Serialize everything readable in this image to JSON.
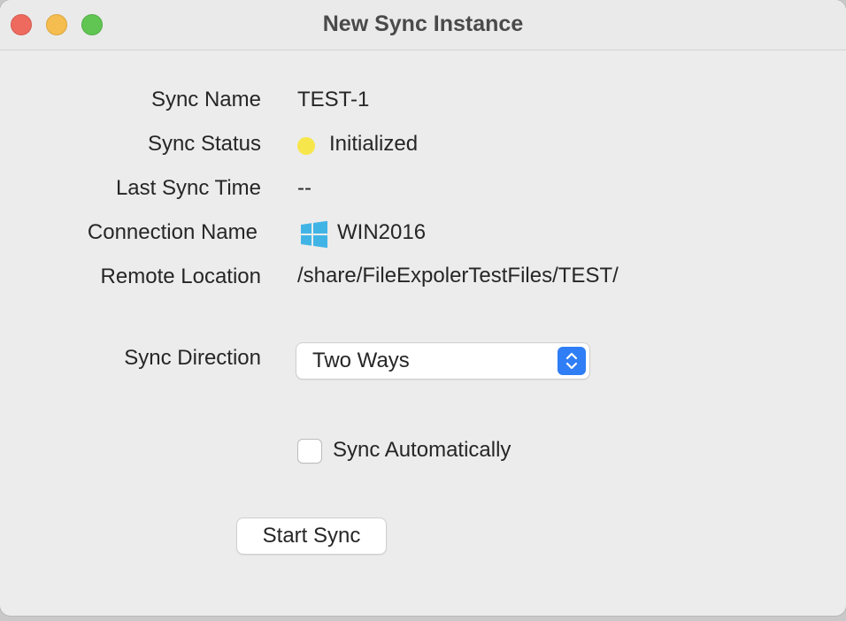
{
  "window": {
    "title": "New Sync Instance",
    "controls": [
      "close",
      "minimize",
      "zoom"
    ]
  },
  "fields": {
    "sync_name": {
      "label": "Sync Name",
      "value": "TEST-1"
    },
    "sync_status": {
      "label": "Sync Status",
      "value": "Initialized",
      "indicator_color": "#f7e64b"
    },
    "last_sync_time": {
      "label": "Last Sync Time",
      "value": "--"
    },
    "connection_name": {
      "label": "Connection Name",
      "value": "WIN2016",
      "icon": "windows-logo-icon"
    },
    "remote_location": {
      "label": "Remote Location",
      "value": "/share/FileExpolerTestFiles/TEST/"
    }
  },
  "sync_direction": {
    "label": "Sync Direction",
    "selected": "Two Ways"
  },
  "sync_automatically": {
    "label": "Sync Automatically",
    "checked": false
  },
  "actions": {
    "start_sync_label": "Start Sync"
  },
  "colors": {
    "accent": "#2f7ef6",
    "close": "#ee6a5f",
    "minimize": "#f5bd4f",
    "zoom": "#61c554",
    "windows_logo": "#41b4e6"
  }
}
